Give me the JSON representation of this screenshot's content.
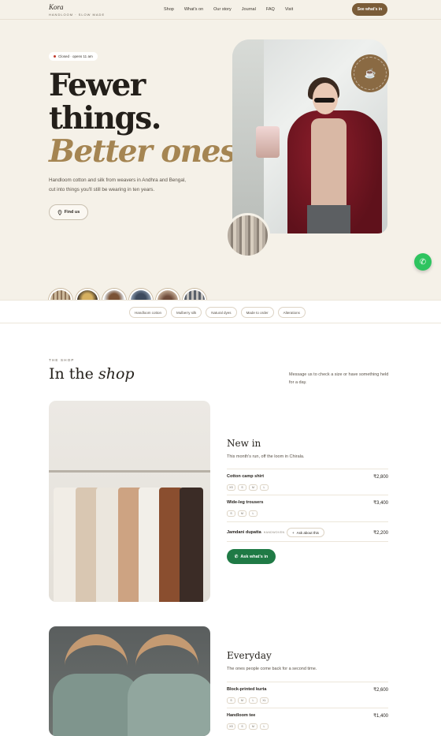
{
  "nav": {
    "brand": "Kora",
    "tagline": "HANDLOOM · SLOW MADE",
    "links": [
      "Shop",
      "What's on",
      "Our story",
      "Journal",
      "FAQ",
      "Visit"
    ],
    "cta": "See what's in"
  },
  "hero": {
    "status": "Closed · opens 11 am",
    "headline_line1": "Fewer",
    "headline_line2": "things.",
    "headline_accent": "Better ones.",
    "subtext": "Handloom cotton and silk from weavers in Andhra and Bengal, cut into things you'll still be wearing in ten years.",
    "find_button": "Find us",
    "badge_text": "WOVEN IN INDIA · MADE IN SMALL RUNS",
    "thumbnails": [
      "thumb-1",
      "thumb-2",
      "thumb-3",
      "thumb-4",
      "thumb-5",
      "thumb-6"
    ]
  },
  "chips": [
    "Handloom cotton",
    "Mulberry silk",
    "Natural dyes",
    "Made to order",
    "Alterations"
  ],
  "shop": {
    "eyebrow": "THE SHOP",
    "title_plain": "In the",
    "title_italic": "shop",
    "note": "Message us to check a size or have something held for a day.",
    "new_in": {
      "title": "New in",
      "subtitle": "This month's run, off the loom in Chirala.",
      "items": [
        {
          "name": "Cotton camp shirt",
          "price": "₹2,800",
          "sizes": [
            "XS",
            "S",
            "M",
            "L"
          ]
        },
        {
          "name": "Wide-leg trousers",
          "price": "₹3,400",
          "sizes": [
            "S",
            "M",
            "L"
          ]
        },
        {
          "name": "Jamdani dupatta",
          "tag": "HANDWOVEN",
          "price": "₹2,200",
          "ask": "Ask about this"
        }
      ],
      "whatsapp_button": "Ask what's in"
    },
    "everyday": {
      "title": "Everyday",
      "subtitle": "The ones people come back for a second time.",
      "items": [
        {
          "name": "Block-printed kurta",
          "price": "₹2,600",
          "sizes": [
            "S",
            "M",
            "L",
            "XL"
          ]
        },
        {
          "name": "Handloom tee",
          "price": "₹1,400",
          "sizes": [
            "XS",
            "S",
            "M",
            "L"
          ]
        }
      ]
    }
  },
  "colors": {
    "accent_brown": "#7a5c38",
    "accent_gold": "#a58552",
    "whatsapp_green": "#2ec45f",
    "hero_bg": "#f5f1e8"
  }
}
